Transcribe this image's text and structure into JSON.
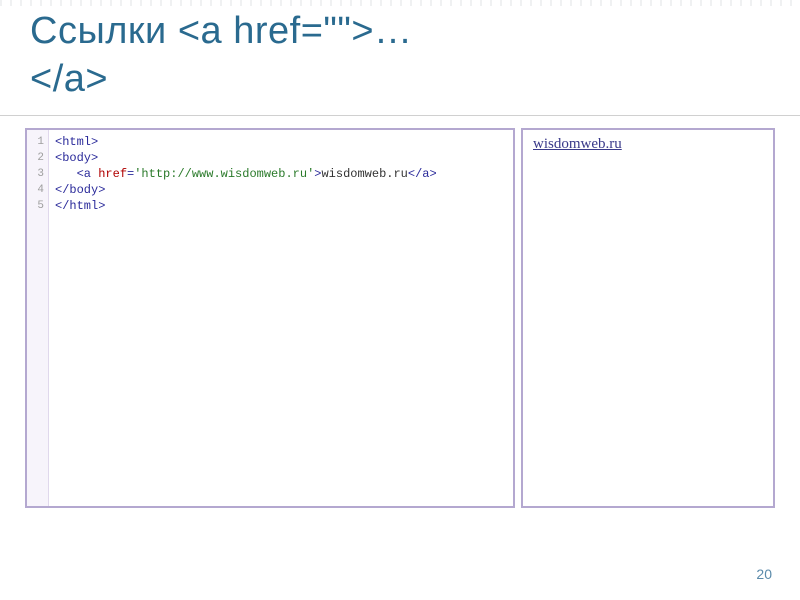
{
  "title_line1": "Ссылки <a href=\"\">…",
  "title_line2": "</a>",
  "code": {
    "line_numbers": [
      "1",
      "2",
      "3",
      "4",
      "5"
    ],
    "l1_tag": "<html>",
    "l2_tag": "<body>",
    "l3_indent": "   ",
    "l3_open": "<a ",
    "l3_attr": "href",
    "l3_eq": "=",
    "l3_val": "'http://www.wisdomweb.ru'",
    "l3_close_open": ">",
    "l3_text": "wisdomweb.ru",
    "l3_close": "</a>",
    "l4_tag": "</body>",
    "l5_tag": "</html>"
  },
  "preview": {
    "link_text": "wisdomweb.ru"
  },
  "page_number": "20"
}
